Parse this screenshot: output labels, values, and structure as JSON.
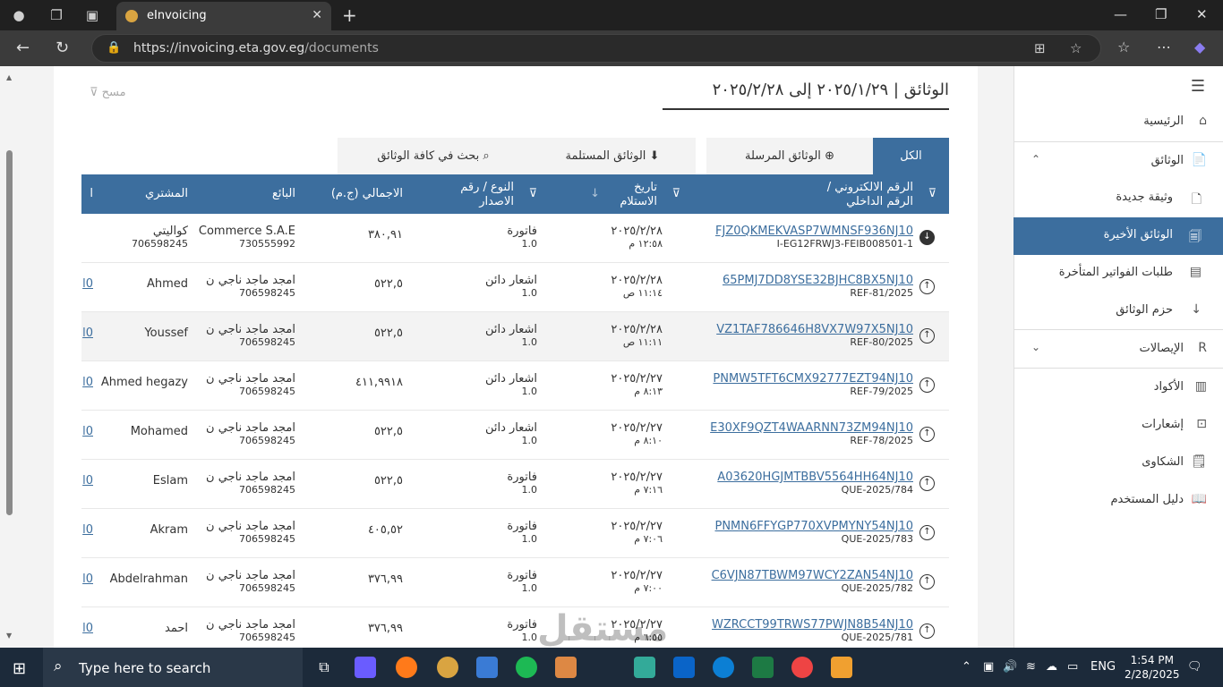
{
  "browser": {
    "tab_title": "eInvoicing",
    "url_host": "https://invoicing.eta.gov.eg",
    "url_path": "/documents"
  },
  "sidebar": {
    "items": [
      {
        "label": "الرئيسية",
        "icon": "home-icon"
      },
      {
        "label": "الوثائق",
        "icon": "document-icon"
      },
      {
        "label": "وثيقة جديدة",
        "icon": "new-doc-icon"
      },
      {
        "label": "الوثائق الأخيرة",
        "icon": "recent-docs-icon"
      },
      {
        "label": "طلبات الفواتير المتأخرة",
        "icon": "late-requests-icon"
      },
      {
        "label": "حزم الوثائق",
        "icon": "download-icon"
      },
      {
        "label": "الإيصالات",
        "icon": "receipt-icon"
      },
      {
        "label": "الأكواد",
        "icon": "barcode-icon"
      },
      {
        "label": "إشعارات",
        "icon": "notification-icon"
      },
      {
        "label": "الشكاوى",
        "icon": "complaint-icon"
      },
      {
        "label": "دليل المستخدم",
        "icon": "book-icon"
      }
    ]
  },
  "page": {
    "title": "الوثائق | ٢٠٢٥/١/٢٩ إلى ٢٠٢٥/٢/٢٨",
    "clear": "مسح"
  },
  "tabs": {
    "all": "الكل",
    "sent": "الوثائق المرسلة",
    "received": "الوثائق المستلمة",
    "search": "بحث في كافة الوثائق"
  },
  "table": {
    "headers": {
      "id": "الرقم الالكتروني / الرقم الداخلي",
      "date": "تاريخ الاستلام",
      "type": "النوع / رقم الاصدار",
      "total": "الاجمالي (ج.م)",
      "seller": "البائع",
      "buyer": "المشتري",
      "extra": "ا"
    },
    "rows": [
      {
        "uuid": "FJZ0QKMEKVASP7WMNSF936NJ10",
        "internal": "I-EG12FRWJ3-FEIB008501-1",
        "date": "٢٠٢٥/٢/٢٨",
        "time": "١٢:٥٨ م",
        "type": "فاتورة",
        "ver": "1.0",
        "total": "٣٨٠,٩١",
        "seller": "Commerce S.A.E",
        "seller_id": "730555992",
        "buyer": "كواليتي",
        "buyer_id": "706598245",
        "extra": ""
      },
      {
        "uuid": "65PMJ7DD8YSE32BJHC8BX5NJ10",
        "internal": "REF-81/2025",
        "date": "٢٠٢٥/٢/٢٨",
        "time": "١١:١٤ ص",
        "type": "اشعار دائن",
        "ver": "1.0",
        "total": "٥٢٢,٥",
        "seller": "امجد ماجد ناجي ن",
        "seller_id": "706598245",
        "buyer": "Ahmed",
        "buyer_id": "",
        "extra": "l0"
      },
      {
        "uuid": "VZ1TAF786646H8VX7W97X5NJ10",
        "internal": "REF-80/2025",
        "date": "٢٠٢٥/٢/٢٨",
        "time": "١١:١١ ص",
        "type": "اشعار دائن",
        "ver": "1.0",
        "total": "٥٢٢,٥",
        "seller": "امجد ماجد ناجي ن",
        "seller_id": "706598245",
        "buyer": "Youssef",
        "buyer_id": "",
        "extra": "l0"
      },
      {
        "uuid": "PNMW5TFT6CMX92777EZT94NJ10",
        "internal": "REF-79/2025",
        "date": "٢٠٢٥/٢/٢٧",
        "time": "٨:١٣ م",
        "type": "اشعار دائن",
        "ver": "1.0",
        "total": "٤١١,٩٩١٨",
        "seller": "امجد ماجد ناجي ن",
        "seller_id": "706598245",
        "buyer": "Ahmed hegazy",
        "buyer_id": "",
        "extra": "l0"
      },
      {
        "uuid": "E30XF9QZT4WAARNN73ZM94NJ10",
        "internal": "REF-78/2025",
        "date": "٢٠٢٥/٢/٢٧",
        "time": "٨:١٠ م",
        "type": "اشعار دائن",
        "ver": "1.0",
        "total": "٥٢٢,٥",
        "seller": "امجد ماجد ناجي ن",
        "seller_id": "706598245",
        "buyer": "Mohamed",
        "buyer_id": "",
        "extra": "l0"
      },
      {
        "uuid": "A03620HGJMTBBV5564HH64NJ10",
        "internal": "QUE-2025/784",
        "date": "٢٠٢٥/٢/٢٧",
        "time": "٧:١٦ م",
        "type": "فاتورة",
        "ver": "1.0",
        "total": "٥٢٢,٥",
        "seller": "امجد ماجد ناجي ن",
        "seller_id": "706598245",
        "buyer": "Eslam",
        "buyer_id": "",
        "extra": "l0"
      },
      {
        "uuid": "PNMN6FFYGP770XVPMYNY54NJ10",
        "internal": "QUE-2025/783",
        "date": "٢٠٢٥/٢/٢٧",
        "time": "٧:٠٦ م",
        "type": "فاتورة",
        "ver": "1.0",
        "total": "٤٠٥,٥٢",
        "seller": "امجد ماجد ناجي ن",
        "seller_id": "706598245",
        "buyer": "Akram",
        "buyer_id": "",
        "extra": "l0"
      },
      {
        "uuid": "C6VJN87TBWM97WCY2ZAN54NJ10",
        "internal": "QUE-2025/782",
        "date": "٢٠٢٥/٢/٢٧",
        "time": "٧:٠٠ م",
        "type": "فاتورة",
        "ver": "1.0",
        "total": "٣٧٦,٩٩",
        "seller": "امجد ماجد ناجي ن",
        "seller_id": "706598245",
        "buyer": "Abdelrahman",
        "buyer_id": "",
        "extra": "l0"
      },
      {
        "uuid": "WZRCCT99TRWS77PWJN8B54NJ10",
        "internal": "QUE-2025/781",
        "date": "٢٠٢٥/٢/٢٧",
        "time": "٦:٥٥ م",
        "type": "فاتورة",
        "ver": "1.0",
        "total": "٣٧٦,٩٩",
        "seller": "امجد ماجد ناجي ن",
        "seller_id": "706598245",
        "buyer": "احمد",
        "buyer_id": "",
        "extra": "l0"
      }
    ]
  },
  "taskbar": {
    "search_placeholder": "Type here to search",
    "lang": "ENG",
    "time": "1:54 PM",
    "date": "2/28/2025"
  },
  "watermark": "مستقل"
}
